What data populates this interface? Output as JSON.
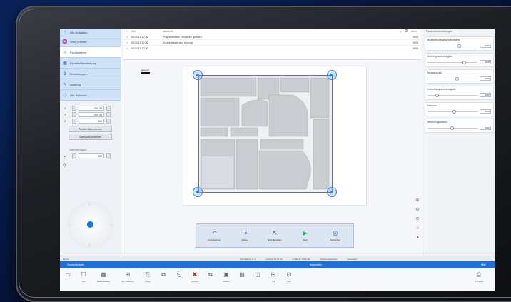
{
  "sidebar": {
    "items": [
      {
        "label": "Alle Aufgaben",
        "icon": "chevron-left-icon",
        "active": false
      },
      {
        "label": "Vom Schnitte",
        "icon": "drop-icon",
        "active": false
      },
      {
        "label": "Positionieren",
        "icon": "crosshair-icon",
        "active": true
      },
      {
        "label": "Einzelteilbearbeitung",
        "icon": "grid-icon",
        "active": false
      },
      {
        "label": "Einstellungen",
        "icon": "gear-icon",
        "active": false
      },
      {
        "label": "Wartung",
        "icon": "wrench-icon",
        "active": false
      },
      {
        "label": "Alle Benutzer",
        "icon": "users-icon",
        "active": false
      }
    ],
    "coords": [
      {
        "axis": "X",
        "value": "000.00"
      },
      {
        "axis": "Y",
        "value": "000.00"
      },
      {
        "axis": "Z",
        "value": "000"
      }
    ],
    "position_button": "Position übernehmen",
    "secondary_button": "Startpunkt anfahren",
    "speed_label": "Geschwindigkeit",
    "speed_value": "100"
  },
  "log": {
    "headers": [
      "Zeit",
      "Nachricht"
    ],
    "rows": [
      {
        "time": "08:00:12 10:36",
        "message": "Programmdatei erfolgreich geladen",
        "code": "0000"
      },
      {
        "time": "08:00:12 10:36",
        "message": "Zuschnittdatei wird erzeugt",
        "code": "0000"
      },
      {
        "time": "08:00:12 10:36",
        "message": "",
        "code": "0000"
      }
    ]
  },
  "legend": {
    "label": "Material"
  },
  "right_panel": {
    "title": "Parametereinstellungen",
    "groups": [
      {
        "title": "Bearbeitungsgeschwindigkeit",
        "value": "0000"
      },
      {
        "title": "Schnittgeschwindigkeit",
        "value": "0000"
      },
      {
        "title": "Messerdruck",
        "value": "0000"
      },
      {
        "title": "Vorschubgeschwindigkeit",
        "value": "0000"
      },
      {
        "title": "Vakuum",
        "value": "0000"
      },
      {
        "title": "Werkzeugabstand",
        "value": "0000"
      }
    ]
  },
  "actions": [
    {
      "label": "Zurücksetzen",
      "icon": "undo-icon",
      "color": "#2b5fa8"
    },
    {
      "label": "Ablöse",
      "icon": "move-icon",
      "color": "#2b5fa8"
    },
    {
      "label": "Schnittposition",
      "icon": "target-icon",
      "color": "#2b5fa8"
    },
    {
      "label": "Start",
      "icon": "play-icon",
      "color": "#2aa84a"
    },
    {
      "label": "Abbrechen",
      "icon": "stop-icon",
      "color": "#2b5fa8"
    }
  ],
  "status": {
    "left": "Bereit",
    "items": [
      "Schnittlänge 0 m",
      "Laufzeit 00:00:00",
      "X 000.00  Y 000.00",
      "Werkzeugwechsel",
      "Schneiden"
    ]
  },
  "ribbon_header": {
    "left": "Zuschnittsdatei",
    "middle": "Bearbeiten",
    "right": "",
    "end": "Hilfe"
  },
  "ribbon": [
    {
      "label": "",
      "icon": "file-icon"
    },
    {
      "label": "Neu",
      "icon": "new-icon"
    },
    {
      "label": "Zuschnittsdatei",
      "icon": "grid-icon"
    },
    {
      "label": "Alle markieren",
      "icon": "select-icon"
    },
    {
      "label": "Öffnen",
      "icon": "open-icon"
    },
    {
      "label": "",
      "icon": "copy-icon"
    },
    {
      "label": "",
      "icon": "paste-icon"
    },
    {
      "label": "Löschen",
      "icon": "delete-icon",
      "red": true
    },
    {
      "label": "",
      "icon": "link-icon"
    },
    {
      "label": "Ansicht",
      "icon": "view-icon"
    },
    {
      "label": "",
      "icon": "table-icon"
    },
    {
      "label": "",
      "icon": "layers-icon"
    },
    {
      "label": "Teil",
      "icon": "part-icon"
    },
    {
      "label": "Aus",
      "icon": "nest-icon"
    },
    {
      "label": "Protokolle",
      "icon": "log-icon"
    }
  ],
  "toolbar_top": {
    "home_icon": "home-icon",
    "gear_icon": "gear-icon",
    "more_label": "Mehr"
  }
}
